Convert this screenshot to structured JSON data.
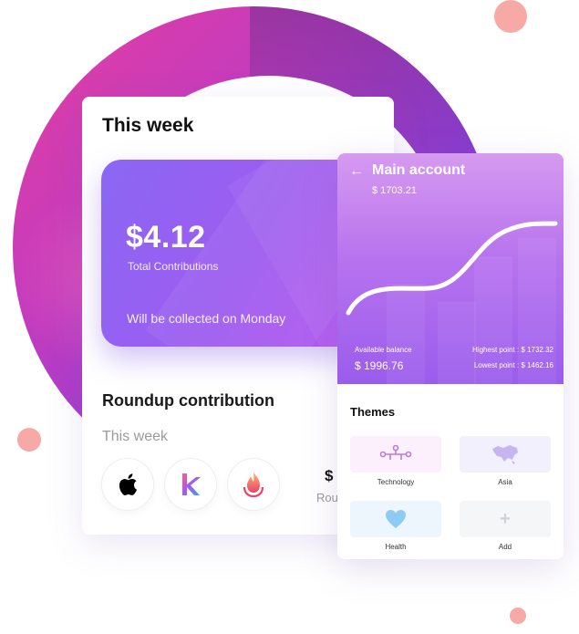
{
  "week_card": {
    "title": "This week",
    "amount": "$4.12",
    "amount_label": "Total Contributions",
    "collected_text": "Will be collected on Monday",
    "roundup_title": "Roundup contribution",
    "roundup_sub": "This week",
    "partial_value": "$",
    "partial_label": "Rou",
    "app_icons": [
      "apple-icon",
      "k-app-icon",
      "flame-app-icon"
    ]
  },
  "main_account": {
    "back_icon": "arrow-left-icon",
    "title": "Main account",
    "balance_header": "$ 1703.21",
    "available_label": "Available balance",
    "available_value": "$ 1996.76",
    "highest": "Highest point : $ 1732.32",
    "lowest": "Lowest point : $ 1462.16"
  },
  "themes": {
    "title": "Themes",
    "items": [
      {
        "label": "Technology",
        "icon": "circuit-icon"
      },
      {
        "label": "Asia",
        "icon": "asia-map-icon"
      },
      {
        "label": "Health",
        "icon": "heart-icon"
      },
      {
        "label": "Add",
        "icon": "plus-icon"
      }
    ]
  },
  "colors": {
    "accent_purple": "#9d5cf0",
    "ring_pink": "#e63ea0",
    "dot": "#f7a9a5"
  }
}
